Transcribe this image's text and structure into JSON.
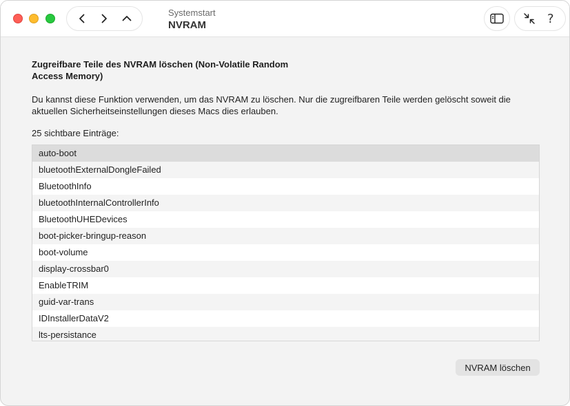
{
  "titlebar": {
    "subtitle": "Systemstart",
    "title": "NVRAM",
    "help_label": "?"
  },
  "nav": {
    "back_icon": "chevron-left-icon",
    "forward_icon": "chevron-right-icon",
    "up_icon": "chevron-up-icon"
  },
  "content": {
    "heading": "Zugreifbare Teile des NVRAM löschen (Non-Volatile Random Access Memory)",
    "description": "Du kannst diese Funktion verwenden, um das NVRAM zu löschen. Nur die zugreifbaren Teile werden gelöscht soweit die aktuellen Sicherheitseinstellungen dieses Macs dies erlauben.",
    "count_label": "25 sichtbare Einträge:"
  },
  "entries": [
    "auto-boot",
    "bluetoothExternalDongleFailed",
    "BluetoothInfo",
    "bluetoothInternalControllerInfo",
    "BluetoothUHEDevices",
    "boot-picker-bringup-reason",
    "boot-volume",
    "display-crossbar0",
    "EnableTRIM",
    "guid-var-trans",
    "IDInstallerDataV2",
    "lts-persistance"
  ],
  "selected_index": 0,
  "actions": {
    "clear_label": "NVRAM löschen"
  },
  "colors": {
    "close": "#fe5f57",
    "minimize": "#febc2e",
    "zoom": "#28c840",
    "selection": "#dcdcdc"
  }
}
